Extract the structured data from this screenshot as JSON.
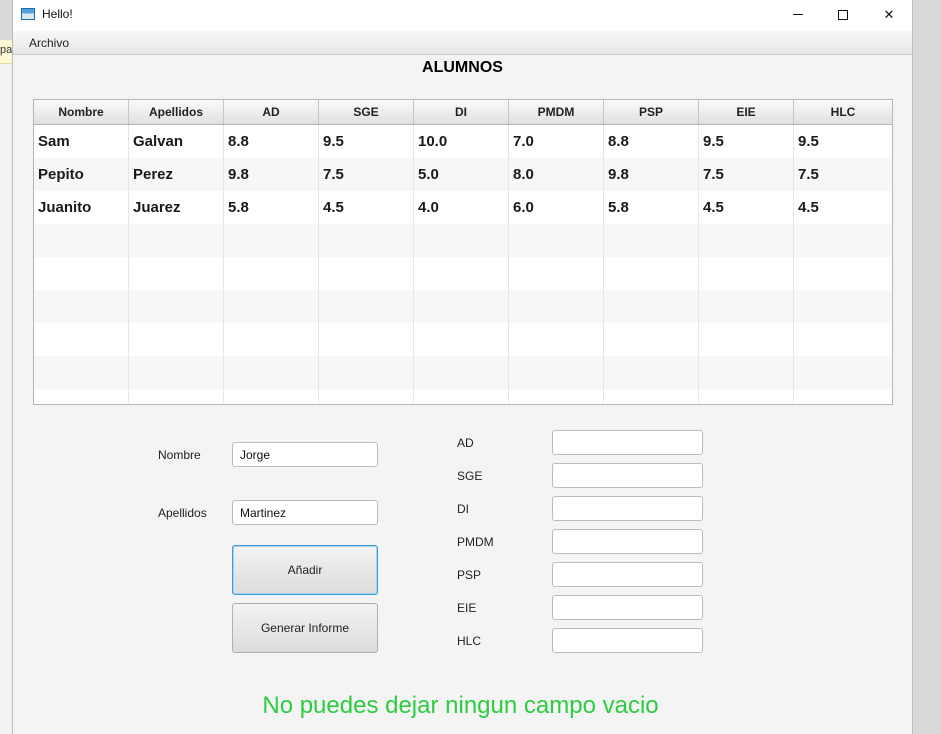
{
  "background": {
    "fragment": "pa"
  },
  "window": {
    "title": "Hello!"
  },
  "menu": {
    "items": [
      "Archivo"
    ]
  },
  "heading": "ALUMNOS",
  "table": {
    "columns": [
      "Nombre",
      "Apellidos",
      "AD",
      "SGE",
      "DI",
      "PMDM",
      "PSP",
      "EIE",
      "HLC"
    ],
    "rows": [
      [
        "Sam",
        "Galvan",
        "8.8",
        "9.5",
        "10.0",
        "7.0",
        "8.8",
        "9.5",
        "9.5"
      ],
      [
        "Pepito",
        "Perez",
        "9.8",
        "7.5",
        "5.0",
        "8.0",
        "9.8",
        "7.5",
        "7.5"
      ],
      [
        "Juanito",
        "Juarez",
        "5.8",
        "4.5",
        "4.0",
        "6.0",
        "5.8",
        "4.5",
        "4.5"
      ],
      [
        "",
        "",
        "",
        "",
        "",
        "",
        "",
        "",
        ""
      ],
      [
        "",
        "",
        "",
        "",
        "",
        "",
        "",
        "",
        ""
      ],
      [
        "",
        "",
        "",
        "",
        "",
        "",
        "",
        "",
        ""
      ],
      [
        "",
        "",
        "",
        "",
        "",
        "",
        "",
        "",
        ""
      ],
      [
        "",
        "",
        "",
        "",
        "",
        "",
        "",
        "",
        ""
      ],
      [
        "",
        "",
        "",
        "",
        "",
        "",
        "",
        "",
        ""
      ]
    ]
  },
  "form": {
    "nombre": {
      "label": "Nombre",
      "value": "Jorge"
    },
    "apellidos": {
      "label": "Apellidos",
      "value": "Martinez"
    },
    "grades": [
      {
        "label": "AD",
        "value": ""
      },
      {
        "label": "SGE",
        "value": ""
      },
      {
        "label": "DI",
        "value": ""
      },
      {
        "label": "PMDM",
        "value": ""
      },
      {
        "label": "PSP",
        "value": ""
      },
      {
        "label": "EIE",
        "value": ""
      },
      {
        "label": "HLC",
        "value": ""
      }
    ],
    "add_button": "Añadir",
    "report_button": "Generar Informe"
  },
  "message": "No puedes dejar ningun campo vacio",
  "colors": {
    "message": "#2ecc40",
    "focus": "#3b9ad9"
  }
}
